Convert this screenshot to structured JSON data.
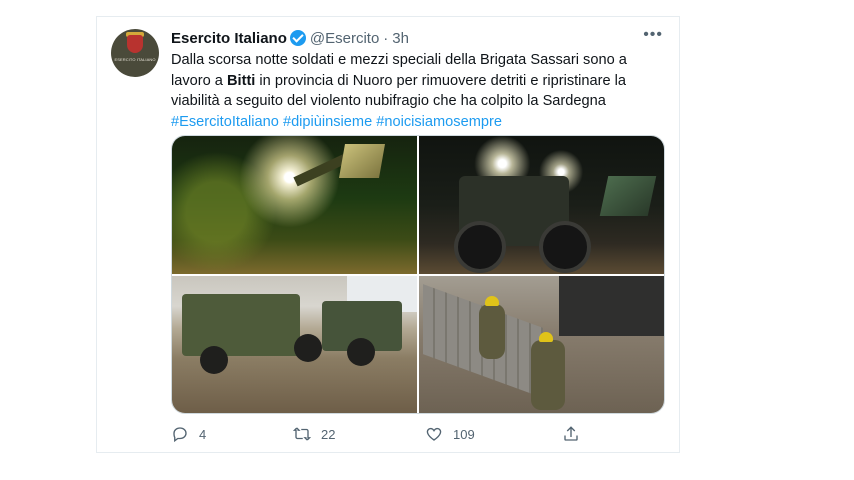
{
  "tweet": {
    "author": {
      "name": "Esercito Italiano",
      "handle": "@Esercito",
      "separator": "·",
      "time": "3h",
      "avatar_text": "ESERCITO ITALIANO"
    },
    "more_label": "•••",
    "text": {
      "part1": "Dalla scorsa notte soldati e mezzi speciali della Brigata Sassari sono a lavoro a ",
      "bold": "Bitti",
      "part2": " in provincia di Nuoro per rimuovere detriti e ripristinare la viabilità a seguito del violento nubifragio che ha colpito la Sardegna",
      "hashtags": "#EsercitoItaliano #dipiùinsieme #noicisiamosempre"
    },
    "media_count": 4,
    "actions": {
      "reply_count": "4",
      "retweet_count": "22",
      "like_count": "109"
    },
    "colors": {
      "accent": "#1d9bf0",
      "secondary_text": "#536471",
      "border": "#e6ecf0"
    }
  }
}
